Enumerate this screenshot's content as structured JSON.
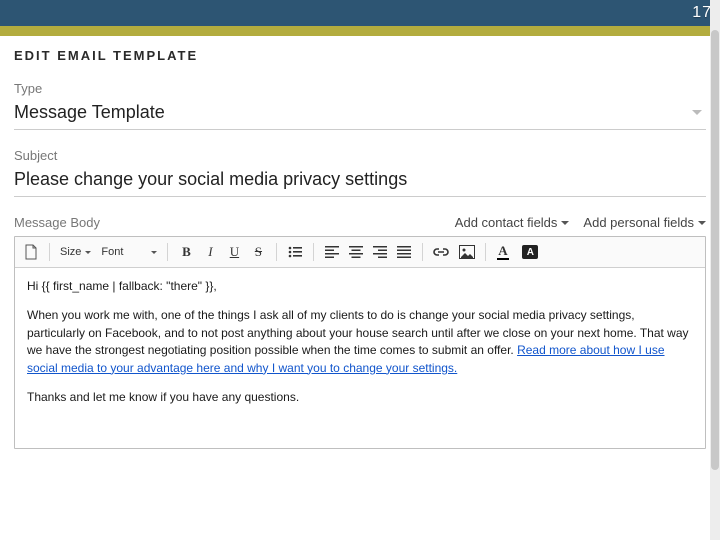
{
  "header": {
    "page_number": "17"
  },
  "title": "EDIT EMAIL TEMPLATE",
  "type_field": {
    "label": "Type",
    "value": "Message Template"
  },
  "subject_field": {
    "label": "Subject",
    "value": "Please change your social media privacy settings"
  },
  "body_section": {
    "label": "Message Body",
    "add_contact": "Add contact fields",
    "add_personal": "Add personal fields"
  },
  "toolbar": {
    "size": "Size",
    "font": "Font",
    "bold": "B",
    "italic": "I",
    "underline": "U",
    "strike": "S",
    "text_color": "A",
    "bg_color": "A"
  },
  "message": {
    "greeting": "Hi {{ first_name | fallback: \"there\" }},",
    "para1_a": "When you work me with, one of the things I ask all of my clients to do is change your social media privacy settings, particularly on Facebook, and to not post anything about your house search until after we close on your next home.  That way we have the strongest negotiating position possible when the time comes to submit an offer.  ",
    "link_text": "Read more about how I use social media to your advantage here and why I want you to change your settings.",
    "closing": "Thanks and let me know if you have any questions."
  }
}
